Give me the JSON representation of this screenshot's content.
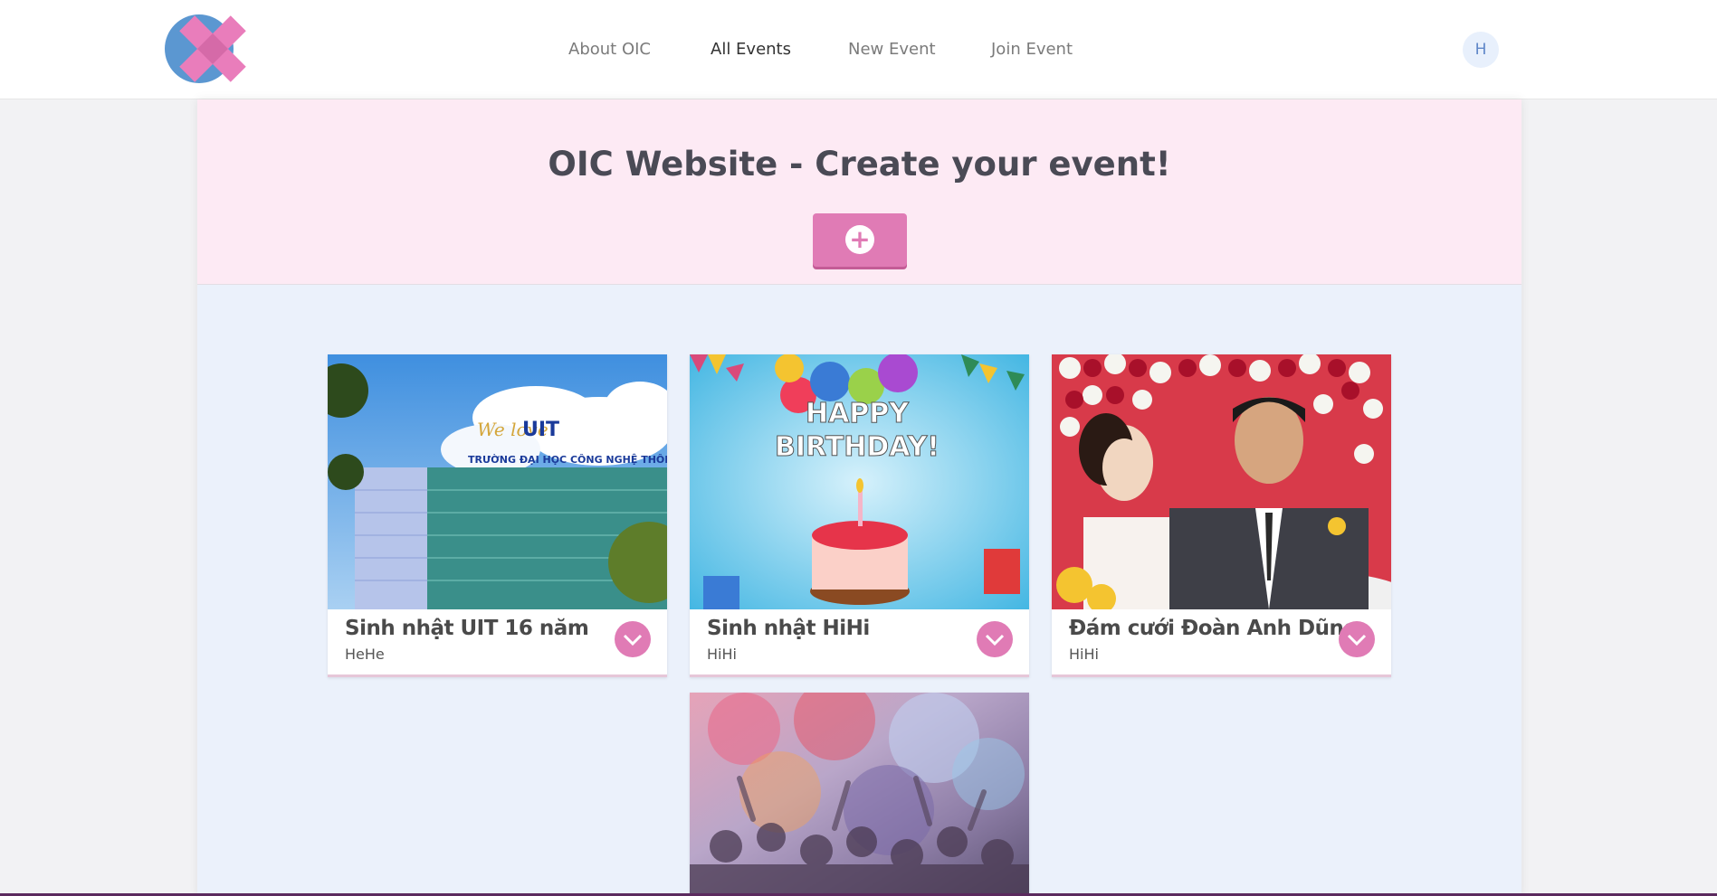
{
  "nav": {
    "items": [
      {
        "label": "About OIC",
        "active": false
      },
      {
        "label": "All Events",
        "active": true
      },
      {
        "label": "New Event",
        "active": false
      },
      {
        "label": "Join Event",
        "active": false
      }
    ]
  },
  "user": {
    "avatar_initial": "H"
  },
  "hero": {
    "title": "OIC Website - Create your event!",
    "add_label": "+"
  },
  "events": [
    {
      "title": "Sinh nhật UIT 16 năm",
      "subtitle": "HeHe",
      "image": "uit-building-photo"
    },
    {
      "title": "Sinh nhật HiHi",
      "subtitle": "HiHi",
      "image": "happy-birthday-cake-photo"
    },
    {
      "title": "Đám cưới Đoàn Anh Dũng",
      "subtitle": "HiHi",
      "image": "wedding-couple-photo"
    },
    {
      "title": "",
      "subtitle": "",
      "image": "color-festival-crowd-photo"
    }
  ],
  "colors": {
    "accent": "#e07bb5",
    "hero_bg": "#fdeaf4",
    "content_bg": "#ebf1fb",
    "logo_blue": "#5b97d1",
    "logo_pink": "#e97dbb"
  },
  "icons": {
    "chevron": "chevron-down-icon",
    "plus": "plus-icon"
  }
}
